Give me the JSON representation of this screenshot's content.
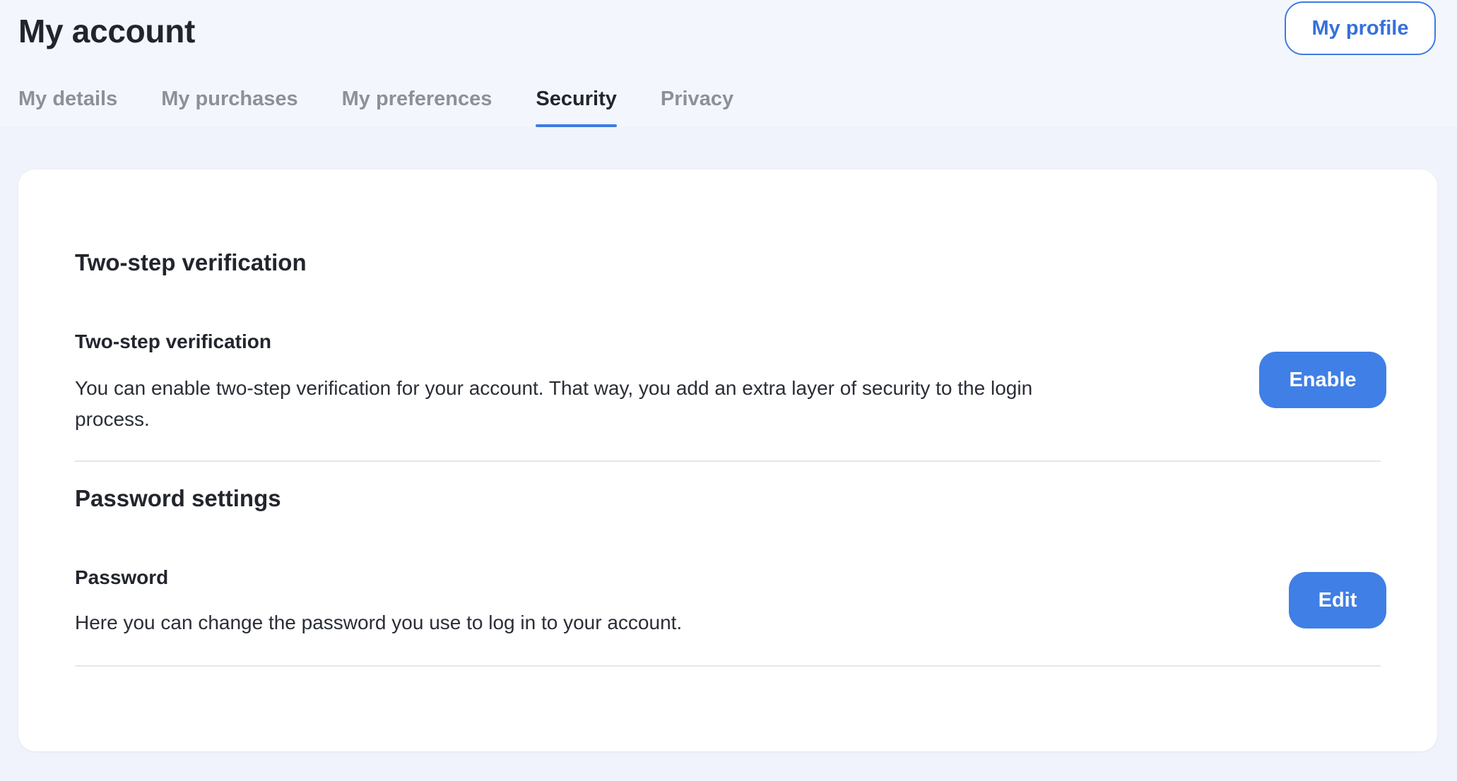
{
  "header": {
    "title": "My account",
    "profile_button_label": "My profile"
  },
  "tabs": [
    {
      "label": "My details",
      "active": false
    },
    {
      "label": "My purchases",
      "active": false
    },
    {
      "label": "My preferences",
      "active": false
    },
    {
      "label": "Security",
      "active": true
    },
    {
      "label": "Privacy",
      "active": false
    }
  ],
  "two_step": {
    "section_title": "Two-step verification",
    "setting_label": "Two-step verification",
    "description": "You can enable two-step verification for your account. That way, you add an extra layer of security to the login process.",
    "button_label": "Enable"
  },
  "password": {
    "section_title": "Password settings",
    "setting_label": "Password",
    "description": "Here you can change the password you use to log in to your account.",
    "button_label": "Edit"
  },
  "colors": {
    "accent": "#3f7fe6",
    "page_background": "#f0f3fb",
    "card_background": "#ffffff"
  }
}
